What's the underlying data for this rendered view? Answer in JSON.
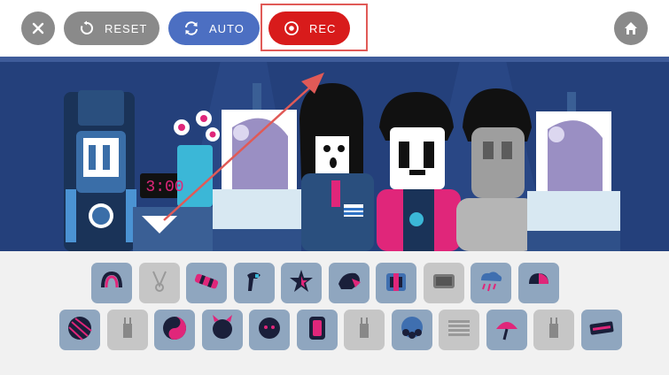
{
  "toolbar": {
    "close_icon": "close-icon",
    "reset_label": "RESET",
    "reset_icon": "reset-icon",
    "auto_label": "AUTO",
    "auto_icon": "auto-loop-icon",
    "rec_label": "REC",
    "rec_icon": "record-icon",
    "home_icon": "home-icon",
    "colors": {
      "gray": "#8a8a8a",
      "auto": "#4c6fc2",
      "rec": "#d81b1b",
      "highlight": "#e05a57"
    }
  },
  "stage": {
    "clock_text": "3:00",
    "characters": [
      "robot",
      "flower-table",
      "painting-left",
      "girl-short-hair",
      "man-clown-makeup",
      "bald-man",
      "painting-right"
    ]
  },
  "palette": {
    "row1": [
      "headphones-icon",
      "necklace-icon",
      "candy-stripe-icon",
      "hair-dryer-icon",
      "star-icon",
      "wig-icon",
      "suit-jacket-icon",
      "alarm-clock-icon",
      "rain-cloud-icon",
      "hat-icon"
    ],
    "row2": [
      "ball-icon",
      "plug-icon",
      "yin-yang-icon",
      "devil-head-icon",
      "flower-head-icon",
      "mirror-icon",
      "plug-icon",
      "curly-hair-icon",
      "flag-icon",
      "umbrella-icon",
      "plug-icon",
      "banner-icon"
    ],
    "state_row1": [
      true,
      false,
      true,
      true,
      true,
      true,
      true,
      false,
      true,
      true
    ],
    "state_row2": [
      true,
      false,
      true,
      true,
      true,
      true,
      false,
      true,
      false,
      true,
      false,
      true
    ]
  }
}
